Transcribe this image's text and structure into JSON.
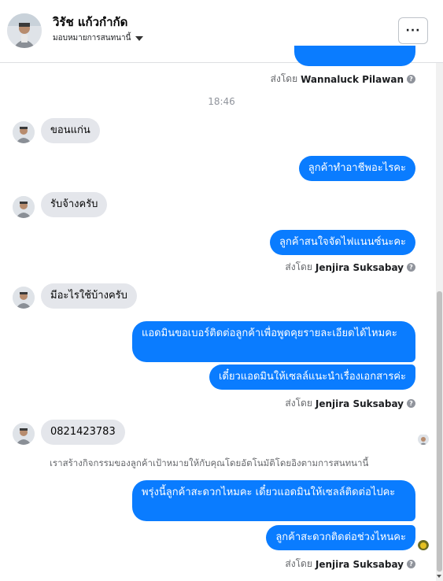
{
  "header": {
    "contact_name": "วิรัช แก้วกำกัด",
    "assign_label": "มอบหมายการสนทนานี้",
    "more_label": "···"
  },
  "messages": {
    "sent_by_prefix": "ส่งโดย",
    "sender_1": "Wannaluck Pilawan",
    "sender_2": "Jenjira Suksabay",
    "time_1": "18:46",
    "m1": "ขอนแก่น",
    "m2": "ลูกค้าทำอาชีพอะไรคะ",
    "m3": "รับจ้างครับ",
    "m4": "ลูกค้าสนใจจัดไฟแนนซ์นะคะ",
    "m5": "มีอะไรใช้บ้างครับ",
    "m6": "แอดมินขอเบอร์ติดต่อลูกค้าเพื่อพูดคุยรายละเอียดได้ไหมคะ",
    "m7": "เดี๋ยวแอดมินให้เซลล์แนะนำเรื่องเอกสารค่ะ",
    "m8": "0821423783",
    "system": "เราสร้างกิจกรรมของลูกค้าเป้าหมายให้กับคุณโดยอัตโนมัติโดยอิงตามการสนทนานี้",
    "m9": "พรุ่งนี้ลูกค้าสะดวกไหมคะ เดี๋ยวแอดมินให้เซลล์ติดต่อไปคะ",
    "m10": "ลูกค้าสะดวกติดต่อช่วงไหนคะ",
    "help_glyph": "?"
  },
  "colors": {
    "outgoing": "#0a7cff",
    "incoming": "#e4e6eb"
  }
}
